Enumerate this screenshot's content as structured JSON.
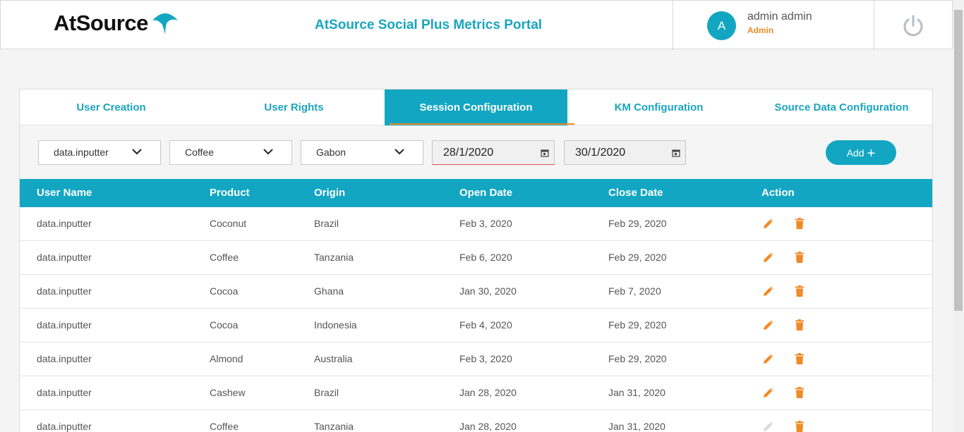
{
  "header": {
    "logo_text": "AtSource",
    "portal_title": "AtSource Social Plus Metrics Portal",
    "user": {
      "avatar_initial": "A",
      "name": "admin admin",
      "role": "Admin"
    }
  },
  "tabs": [
    {
      "label": "User Creation",
      "active": false
    },
    {
      "label": "User Rights",
      "active": false
    },
    {
      "label": "Session Configuration",
      "active": true
    },
    {
      "label": "KM Configuration",
      "active": false
    },
    {
      "label": "Source Data Configuration",
      "active": false
    }
  ],
  "filters": {
    "user": "data.inputter",
    "product": "Coffee",
    "origin": "Gabon",
    "open_date": "28/1/2020",
    "close_date": "30/1/2020",
    "add_label": "Add"
  },
  "table": {
    "columns": [
      "User Name",
      "Product",
      "Origin",
      "Open Date",
      "Close Date",
      "Action"
    ],
    "rows": [
      [
        "data.inputter",
        "Coconut",
        "Brazil",
        "Feb 3, 2020",
        "Feb 29, 2020"
      ],
      [
        "data.inputter",
        "Coffee",
        "Tanzania",
        "Feb 6, 2020",
        "Feb 29, 2020"
      ],
      [
        "data.inputter",
        "Cocoa",
        "Ghana",
        "Jan 30, 2020",
        "Feb 7, 2020"
      ],
      [
        "data.inputter",
        "Cocoa",
        "Indonesia",
        "Feb 4, 2020",
        "Feb 29, 2020"
      ],
      [
        "data.inputter",
        "Almond",
        "Australia",
        "Feb 3, 2020",
        "Feb 29, 2020"
      ],
      [
        "data.inputter",
        "Cashew",
        "Brazil",
        "Jan 28, 2020",
        "Jan 31, 2020"
      ],
      [
        "data.inputter",
        "Coffee",
        "Tanzania",
        "Jan 28, 2020",
        "Jan 31, 2020"
      ]
    ]
  },
  "colors": {
    "accent": "#12a6c2",
    "orange": "#f08a24"
  }
}
